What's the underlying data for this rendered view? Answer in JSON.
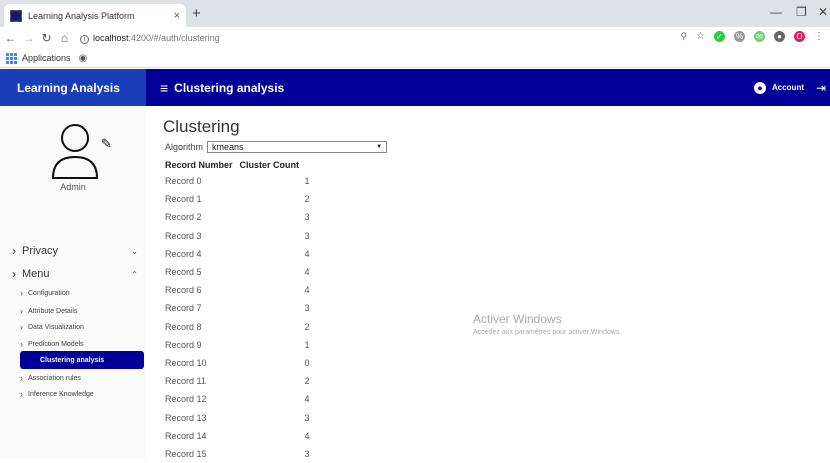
{
  "browser": {
    "tab_title": "Learning Analysis Platform",
    "tab_close": "×",
    "new_tab": "+",
    "url_host": "localhost",
    "url_path": ":4200/#/auth/clustering",
    "bookmark_apps": "Applications"
  },
  "header": {
    "brand": "Learning Analysis",
    "page_title": "Clustering analysis",
    "account_label": "Account"
  },
  "sidebar": {
    "user_name": "Admin",
    "sections": [
      {
        "label": "Privacy"
      },
      {
        "label": "Menu"
      }
    ],
    "menu_items": [
      {
        "label": "Configuration"
      },
      {
        "label": "Attribute Details"
      },
      {
        "label": "Data Visualization"
      },
      {
        "label": "Prediction Models"
      },
      {
        "label": "Clustering analysis"
      },
      {
        "label": "Association rules"
      },
      {
        "label": "Inference Knowledge"
      }
    ]
  },
  "main": {
    "title": "Clustering",
    "algorithm_label": "Algorithm",
    "algorithm_value": "kmeans",
    "columns": [
      "Record Number",
      "Cluster Count"
    ],
    "rows": [
      {
        "record": "Record 0",
        "count": "1"
      },
      {
        "record": "Record 1",
        "count": "2"
      },
      {
        "record": "Record 2",
        "count": "3"
      },
      {
        "record": "Record 3",
        "count": "3"
      },
      {
        "record": "Record 4",
        "count": "4"
      },
      {
        "record": "Record 5",
        "count": "4"
      },
      {
        "record": "Record 6",
        "count": "4"
      },
      {
        "record": "Record 7",
        "count": "3"
      },
      {
        "record": "Record 8",
        "count": "2"
      },
      {
        "record": "Record 9",
        "count": "1"
      },
      {
        "record": "Record 10",
        "count": "0"
      },
      {
        "record": "Record 11",
        "count": "2"
      },
      {
        "record": "Record 12",
        "count": "4"
      },
      {
        "record": "Record 13",
        "count": "3"
      },
      {
        "record": "Record 14",
        "count": "4"
      },
      {
        "record": "Record 15",
        "count": "3"
      }
    ]
  },
  "watermark": {
    "line1": "Activer Windows",
    "line2": "Accédez aux paramètres pour activer Windows."
  },
  "colors": {
    "header_bg": "#000099",
    "brand_bg": "#1a3db8",
    "active_item_bg": "#000099"
  }
}
